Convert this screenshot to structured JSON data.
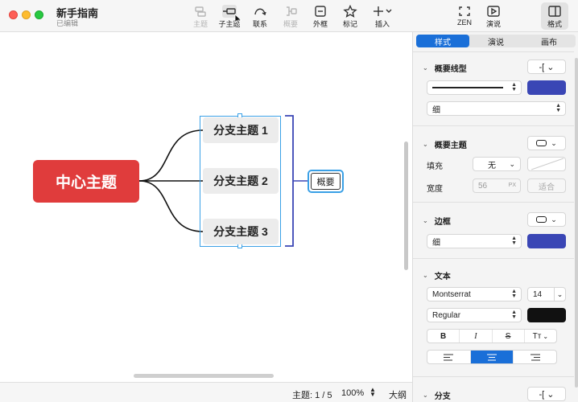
{
  "window": {
    "title": "新手指南",
    "subtitle": "已编辑"
  },
  "toolbar": {
    "topic": "主题",
    "subtopic": "子主题",
    "relationship": "联系",
    "summary": "概要",
    "boundary": "外框",
    "marker": "标记",
    "insert": "插入",
    "zen": "ZEN",
    "present": "演说",
    "format": "格式"
  },
  "canvas": {
    "central_topic": "中心主题",
    "branches": [
      "分支主题 1",
      "分支主题 2",
      "分支主题 3"
    ],
    "summary_topic": "概要"
  },
  "status": {
    "topic_count": "主题: 1 / 5",
    "zoom": "100%",
    "outline": "大纲"
  },
  "panel": {
    "tabs": [
      "样式",
      "演说",
      "画布"
    ],
    "summary_line": {
      "title": "概要线型",
      "line_weight": "细",
      "color": "#3a46b5"
    },
    "summary_topic": {
      "title": "概要主题",
      "fill_label": "填充",
      "fill_value": "无",
      "width_label": "宽度",
      "width_value": "56",
      "width_unit": "PX",
      "fit_button": "适合"
    },
    "border": {
      "title": "边框",
      "weight": "细",
      "color": "#3a46b5"
    },
    "text": {
      "title": "文本",
      "font": "Montserrat",
      "size": "14",
      "style": "Regular",
      "color": "#111111",
      "bold": "B",
      "italic": "I",
      "strike": "S",
      "case": "Tт"
    },
    "branch": {
      "title": "分支"
    }
  },
  "colors": {
    "accent": "#1a6fd8",
    "central": "#e03c3c",
    "selection": "#3aa0e6",
    "summary_bracket": "#3a46b5"
  }
}
